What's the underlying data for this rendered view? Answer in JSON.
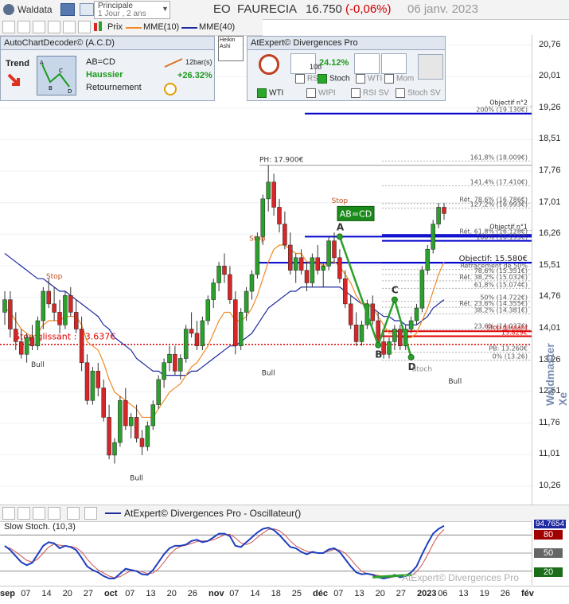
{
  "app": {
    "name": "Waldata",
    "period_top": "Principale",
    "period_bottom": "1 Jour , 2 ans"
  },
  "header": {
    "ticker": "EO",
    "company": "FAURECIA",
    "price": "16.750",
    "change": "(-0,06%)",
    "date": "06 janv. 2023"
  },
  "legend": {
    "prix": "Prix",
    "mme10": "MME(10)",
    "mme40": "MME(40)"
  },
  "acd": {
    "title": "AutoChartDecoder© (A.C.D)",
    "trend_label": "Trend",
    "pattern": "AB=CD",
    "direction": "Haussier",
    "status": "Retournement",
    "bars": "12bar(s)",
    "gain": "+26.32%"
  },
  "heikin": "Heikin Ashi",
  "divergences": {
    "title": "AtExpert© Divergences Pro",
    "percent": "24.12%",
    "bars": "10b",
    "items": [
      "RSI",
      "Stoch",
      "WTI",
      "Mom",
      "WTI",
      "WIPI",
      "RSI SV",
      "Stoch SV"
    ],
    "checked": [
      false,
      true,
      false,
      false,
      true,
      false,
      false,
      false
    ]
  },
  "oscillator": {
    "title": "AtExpert© Divergences Pro - Oscillateur()",
    "indicator": "Slow Stoch. (10,3)",
    "watermark": "AtExpert© Divergences Pro",
    "levels": [
      "80",
      "50",
      "20"
    ],
    "current": "94.7654"
  },
  "brand_watermark": "Waldmaster Xe",
  "colors": {
    "up": "#2ca02c",
    "down": "#d62728",
    "mme10": "#f08a24",
    "mme40": "#1e2aa0",
    "blue_level": "#0000cc",
    "red_level": "#e00000",
    "oscillator": "#1f3fbf",
    "signal": "#d05050"
  },
  "chart_data": [
    {
      "type": "candlestick",
      "title": "EO - FAURECIA",
      "ylim": [
        9.9,
        21.0
      ],
      "yticks": [
        "20,76",
        "20,01",
        "19,26",
        "18,51",
        "17,76",
        "17,01",
        "16,26",
        "15,51",
        "14,76",
        "14,01",
        "13,26",
        "12,51",
        "11,76",
        "11,01",
        "10,26"
      ],
      "xticks": [
        "sep",
        "07",
        "14",
        "20",
        "27",
        "oct",
        "07",
        "13",
        "20",
        "26",
        "nov",
        "07",
        "14",
        "18",
        "25",
        "déc",
        "07",
        "13",
        "20",
        "27",
        "2023",
        "06",
        "13",
        "19",
        "26",
        "fév"
      ],
      "ohlc": [
        [
          14.4,
          14.9,
          14.1,
          14.7
        ],
        [
          14.7,
          14.9,
          13.8,
          14.0
        ],
        [
          14.0,
          14.4,
          13.5,
          13.7
        ],
        [
          13.7,
          14.0,
          13.3,
          13.4
        ],
        [
          13.4,
          13.9,
          13.2,
          13.8
        ],
        [
          13.8,
          14.1,
          13.5,
          13.6
        ],
        [
          13.6,
          14.3,
          13.5,
          14.2
        ],
        [
          14.2,
          15.0,
          14.0,
          14.9
        ],
        [
          14.9,
          15.2,
          14.5,
          14.6
        ],
        [
          14.6,
          15.0,
          14.2,
          14.4
        ],
        [
          14.4,
          14.7,
          13.9,
          14.1
        ],
        [
          14.1,
          14.9,
          14.0,
          14.8
        ],
        [
          14.8,
          15.0,
          14.3,
          14.4
        ],
        [
          14.4,
          14.7,
          13.9,
          14.0
        ],
        [
          14.0,
          14.3,
          13.0,
          13.2
        ],
        [
          13.2,
          13.4,
          12.2,
          12.3
        ],
        [
          12.3,
          13.1,
          12.2,
          13.0
        ],
        [
          13.0,
          13.2,
          12.4,
          12.6
        ],
        [
          12.6,
          12.8,
          11.8,
          11.9
        ],
        [
          11.9,
          12.2,
          10.9,
          11.0
        ],
        [
          11.0,
          11.4,
          10.8,
          11.3
        ],
        [
          11.3,
          12.4,
          11.2,
          12.3
        ],
        [
          12.3,
          12.6,
          11.6,
          11.7
        ],
        [
          11.7,
          12.0,
          11.4,
          11.9
        ],
        [
          11.9,
          12.2,
          11.3,
          11.4
        ],
        [
          11.4,
          11.6,
          11.0,
          11.2
        ],
        [
          11.2,
          11.8,
          11.1,
          11.7
        ],
        [
          11.7,
          12.3,
          11.6,
          12.2
        ],
        [
          12.2,
          12.9,
          12.1,
          12.8
        ],
        [
          12.8,
          13.3,
          12.6,
          13.2
        ],
        [
          13.2,
          13.6,
          13.0,
          13.4
        ],
        [
          13.4,
          13.6,
          12.9,
          13.0
        ],
        [
          13.0,
          13.4,
          12.8,
          13.3
        ],
        [
          13.3,
          14.1,
          13.2,
          14.0
        ],
        [
          14.0,
          14.4,
          13.8,
          13.9
        ],
        [
          13.9,
          14.2,
          13.5,
          13.6
        ],
        [
          13.6,
          14.3,
          13.5,
          14.2
        ],
        [
          14.2,
          14.8,
          14.1,
          14.7
        ],
        [
          14.7,
          15.2,
          14.5,
          15.1
        ],
        [
          15.1,
          15.6,
          14.9,
          15.5
        ],
        [
          15.5,
          15.8,
          15.1,
          15.3
        ],
        [
          15.3,
          15.5,
          14.6,
          14.7
        ],
        [
          14.7,
          14.9,
          13.4,
          13.6
        ],
        [
          13.6,
          14.5,
          13.5,
          14.4
        ],
        [
          14.4,
          15.0,
          14.2,
          14.9
        ],
        [
          14.9,
          15.4,
          14.7,
          15.3
        ],
        [
          15.3,
          16.3,
          15.2,
          16.2
        ],
        [
          16.2,
          17.2,
          16.0,
          17.1
        ],
        [
          17.1,
          17.9,
          16.8,
          17.5
        ],
        [
          17.5,
          17.7,
          16.7,
          16.9
        ],
        [
          16.9,
          17.1,
          16.3,
          16.5
        ],
        [
          16.5,
          16.8,
          15.9,
          16.0
        ],
        [
          16.0,
          16.3,
          15.3,
          15.4
        ],
        [
          15.4,
          15.8,
          15.1,
          15.7
        ],
        [
          15.7,
          15.9,
          15.3,
          15.4
        ],
        [
          15.4,
          15.6,
          14.9,
          15.1
        ],
        [
          15.1,
          15.8,
          15.0,
          15.7
        ],
        [
          15.7,
          16.0,
          15.3,
          15.4
        ],
        [
          15.4,
          15.6,
          15.0,
          15.5
        ],
        [
          15.5,
          16.2,
          15.4,
          16.1
        ],
        [
          16.1,
          16.3,
          15.6,
          15.7
        ],
        [
          15.7,
          15.9,
          15.1,
          15.2
        ],
        [
          15.2,
          15.4,
          14.5,
          14.6
        ],
        [
          14.6,
          14.8,
          14.0,
          14.1
        ],
        [
          14.1,
          14.4,
          13.6,
          13.7
        ],
        [
          13.7,
          14.2,
          13.6,
          14.1
        ],
        [
          14.1,
          14.7,
          14.0,
          14.6
        ],
        [
          14.6,
          14.8,
          14.1,
          14.2
        ],
        [
          14.2,
          14.4,
          13.6,
          13.7
        ],
        [
          13.7,
          14.0,
          13.3,
          13.4
        ],
        [
          13.4,
          13.8,
          13.3,
          13.7
        ],
        [
          13.7,
          14.1,
          13.5,
          14.0
        ],
        [
          14.0,
          14.1,
          13.5,
          13.6
        ],
        [
          13.6,
          14.1,
          13.5,
          14.0
        ],
        [
          14.0,
          14.3,
          13.9,
          14.2
        ],
        [
          14.2,
          14.6,
          14.1,
          14.5
        ],
        [
          14.5,
          15.5,
          14.4,
          15.4
        ],
        [
          15.4,
          16.0,
          15.3,
          15.9
        ],
        [
          15.9,
          16.6,
          15.8,
          16.5
        ],
        [
          16.5,
          17.0,
          16.4,
          16.9
        ],
        [
          16.9,
          17.0,
          16.6,
          16.75
        ]
      ],
      "mme10": [
        14.5,
        14.4,
        14.2,
        14.0,
        13.9,
        13.8,
        13.9,
        14.1,
        14.2,
        14.2,
        14.2,
        14.3,
        14.3,
        14.3,
        14.1,
        13.7,
        13.6,
        13.5,
        13.2,
        12.8,
        12.5,
        12.4,
        12.3,
        12.2,
        12.1,
        11.9,
        11.9,
        11.9,
        12.1,
        12.3,
        12.5,
        12.6,
        12.7,
        12.9,
        13.1,
        13.2,
        13.4,
        13.6,
        13.9,
        14.2,
        14.4,
        14.4,
        14.2,
        14.2,
        14.3,
        14.5,
        14.8,
        15.2,
        15.6,
        15.9,
        16.0,
        16.0,
        15.9,
        15.8,
        15.8,
        15.6,
        15.6,
        15.6,
        15.5,
        15.6,
        15.6,
        15.5,
        15.3,
        15.1,
        14.8,
        14.6,
        14.6,
        14.5,
        14.3,
        14.1,
        13.9,
        13.9,
        13.8,
        13.8,
        13.8,
        13.9,
        14.2,
        14.5,
        14.9,
        15.3,
        15.6
      ],
      "mme40": [
        15.8,
        15.7,
        15.6,
        15.5,
        15.4,
        15.3,
        15.2,
        15.2,
        15.1,
        15.0,
        14.9,
        14.9,
        14.8,
        14.7,
        14.6,
        14.5,
        14.4,
        14.3,
        14.1,
        14.0,
        13.8,
        13.7,
        13.6,
        13.5,
        13.3,
        13.2,
        13.1,
        13.0,
        13.0,
        12.9,
        12.9,
        12.9,
        12.9,
        12.9,
        13.0,
        13.0,
        13.1,
        13.2,
        13.3,
        13.4,
        13.5,
        13.6,
        13.6,
        13.7,
        13.8,
        13.9,
        14.1,
        14.3,
        14.5,
        14.6,
        14.7,
        14.8,
        14.9,
        14.9,
        15.0,
        15.0,
        15.0,
        15.0,
        15.0,
        15.0,
        15.0,
        15.0,
        14.9,
        14.8,
        14.7,
        14.6,
        14.6,
        14.5,
        14.4,
        14.3,
        14.3,
        14.2,
        14.2,
        14.1,
        14.1,
        14.1,
        14.2,
        14.3,
        14.5,
        14.6,
        14.7
      ],
      "levels": [
        {
          "label": "Objectif n°2",
          "value": 19.3
        },
        {
          "label": "200% (19.130€)",
          "value": 19.13
        },
        {
          "label": "161,8% (18.009€)",
          "value": 18.0
        },
        {
          "label": "141,4% (17.410€)",
          "value": 17.41
        },
        {
          "label": "Rét. 78,6% (16.786€)",
          "value": 16.99
        },
        {
          "label": "127,2% (16.993€)",
          "value": 16.88
        },
        {
          "label": "Objectif n°1",
          "value": 16.35
        },
        {
          "label": "Rét. 61,8% (16.128€)",
          "value": 16.24
        },
        {
          "label": "100% (16.195€)",
          "value": 16.1
        },
        {
          "label": "Objectif: 15.580€",
          "value": 15.58
        },
        {
          "label": "Retracement de 50%",
          "value": 15.42
        },
        {
          "label": "78,6% (15.351€)",
          "value": 15.3
        },
        {
          "label": "Rét. 38,2% (15.032€)",
          "value": 15.15
        },
        {
          "label": "61,8% (15.074€)",
          "value": 14.97
        },
        {
          "label": "50% (14.722€)",
          "value": 14.66
        },
        {
          "label": "Rét. 23,6% (14.355€)",
          "value": 14.52
        },
        {
          "label": "38,2% (14.381€)",
          "value": 14.36
        },
        {
          "label": "23,6% (14.037€)",
          "value": 13.98
        },
        {
          "label": "Stop glissant",
          "value": 13.95
        },
        {
          "label": "13.829€",
          "value": 13.83
        },
        {
          "label": "PB: 13.260€",
          "value": 13.45
        },
        {
          "label": "0% (13.26)",
          "value": 13.26
        }
      ],
      "stop_label": "Stop glissant : 13.637€",
      "stop_value": 13.637,
      "ph_label": "PH: 17.900€",
      "pattern_points": [
        {
          "label": "A",
          "value": 16.2
        },
        {
          "label": "B",
          "value": 13.62
        },
        {
          "label": "C",
          "value": 14.7
        },
        {
          "label": "D",
          "value": 13.33
        }
      ],
      "pattern_name": "AB=CD",
      "annotations": [
        "Stop",
        "Stop",
        "Stop",
        "Bull",
        "Bull",
        "Bull",
        "Bull",
        "Stoch"
      ]
    },
    {
      "type": "line",
      "title": "Slow Stoch. (10,3)",
      "ylim": [
        0,
        100
      ],
      "k": [
        62,
        55,
        45,
        35,
        30,
        34,
        48,
        62,
        68,
        66,
        58,
        62,
        60,
        55,
        42,
        28,
        22,
        18,
        12,
        8,
        8,
        16,
        24,
        22,
        20,
        15,
        14,
        22,
        35,
        48,
        58,
        62,
        62,
        64,
        70,
        72,
        68,
        70,
        76,
        82,
        82,
        78,
        62,
        60,
        68,
        76,
        84,
        90,
        92,
        88,
        80,
        70,
        60,
        58,
        52,
        48,
        52,
        50,
        50,
        56,
        58,
        52,
        40,
        28,
        18,
        15,
        16,
        14,
        10,
        8,
        10,
        14,
        10,
        12,
        18,
        28,
        48,
        66,
        82,
        90,
        95
      ],
      "d": [
        60,
        58,
        52,
        45,
        38,
        35,
        40,
        50,
        60,
        65,
        63,
        62,
        61,
        59,
        52,
        40,
        30,
        22,
        17,
        12,
        9,
        11,
        16,
        21,
        21,
        19,
        16,
        17,
        24,
        35,
        47,
        56,
        61,
        63,
        66,
        69,
        70,
        70,
        72,
        76,
        80,
        81,
        75,
        67,
        64,
        68,
        76,
        83,
        89,
        90,
        87,
        80,
        70,
        62,
        57,
        53,
        51,
        50,
        51,
        53,
        56,
        55,
        50,
        40,
        29,
        20,
        16,
        15,
        13,
        11,
        9,
        11,
        11,
        12,
        13,
        19,
        31,
        47,
        65,
        80,
        89
      ]
    }
  ]
}
